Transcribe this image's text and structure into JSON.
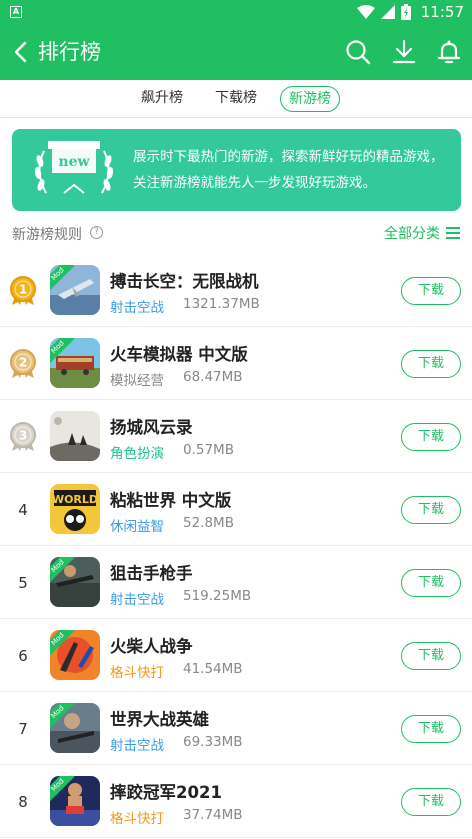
{
  "status_bar": {
    "time": "11:57",
    "notification_icon": "A"
  },
  "header": {
    "title": "排行榜"
  },
  "tabs": [
    {
      "label": "飙升榜",
      "active": false
    },
    {
      "label": "下载榜",
      "active": false
    },
    {
      "label": "新游榜",
      "active": true
    }
  ],
  "banner": {
    "badge_text": "new",
    "text": "展示时下最热门的新游，探索新鲜好玩的精品游戏，关注新游榜就能先人一步发现好玩游戏。"
  },
  "rules": {
    "label": "新游榜规则",
    "help": "?",
    "all_categories": "全部分类"
  },
  "download_label": "下载",
  "mod_label": "Mod",
  "colors": {
    "brand_green": "#1fbf62",
    "category_blue": "#3a9be0",
    "category_teal": "#1fbf92",
    "category_orange": "#f39a1e"
  },
  "apps": [
    {
      "rank": "1",
      "medal": "gold",
      "name": "搏击长空：无限战机",
      "category": "射击空战",
      "category_color": "#3a9be0",
      "size": "1321.37MB",
      "mod": true
    },
    {
      "rank": "2",
      "medal": "silver-gold",
      "name": "火车模拟器 中文版",
      "category": "模拟经营",
      "category_color": "#888888",
      "size": "68.47MB",
      "mod": true
    },
    {
      "rank": "3",
      "medal": "silver",
      "name": "扬城风云录",
      "category": "角色扮演",
      "category_color": "#1fbf92",
      "size": "0.57MB",
      "mod": false
    },
    {
      "rank": "4",
      "medal": "",
      "name": "粘粘世界 中文版",
      "category": "休闲益智",
      "category_color": "#3a9be0",
      "size": "52.8MB",
      "mod": false
    },
    {
      "rank": "5",
      "medal": "",
      "name": "狙击手枪手",
      "category": "射击空战",
      "category_color": "#3a9be0",
      "size": "519.25MB",
      "mod": true
    },
    {
      "rank": "6",
      "medal": "",
      "name": "火柴人战争",
      "category": "格斗快打",
      "category_color": "#f39a1e",
      "size": "41.54MB",
      "mod": true
    },
    {
      "rank": "7",
      "medal": "",
      "name": "世界大战英雄",
      "category": "射击空战",
      "category_color": "#3a9be0",
      "size": "69.33MB",
      "mod": true
    },
    {
      "rank": "8",
      "medal": "",
      "name": "摔跤冠军2021",
      "category": "格斗快打",
      "category_color": "#f39a1e",
      "size": "37.74MB",
      "mod": true
    }
  ]
}
